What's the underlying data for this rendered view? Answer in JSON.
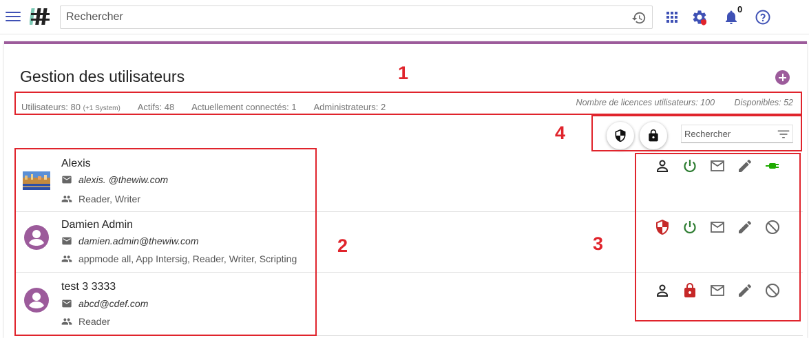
{
  "header": {
    "search_placeholder": "Rechercher",
    "notifications_count": "0",
    "icons": [
      "menu-icon",
      "app-logo",
      "history-icon",
      "apps-grid-icon",
      "admin-settings-icon",
      "bell-icon",
      "help-icon"
    ]
  },
  "page": {
    "title": "Gestion des utilisateurs",
    "accent_color": "#9c5b9b"
  },
  "stats": {
    "users": "Utilisateurs: 80",
    "users_system": "(+1 System)",
    "active": "Actifs: 48",
    "connected": "Actuellement connectés: 1",
    "admins": "Administrateurs: 2",
    "licences": "Nombre de licences utilisateurs: 100",
    "available": "Disponibles: 52"
  },
  "filter": {
    "search_placeholder": "Rechercher"
  },
  "users": [
    {
      "name": "Alexis",
      "email": "alexis. @thewiw.com",
      "groups": "Reader, Writer",
      "avatar": "photo",
      "actions": [
        "user-icon",
        "power-icon",
        "mail-icon",
        "edit-icon",
        "plug-icon"
      ]
    },
    {
      "name": "Damien Admin",
      "email": "damien.admin@thewiw.com",
      "groups": "appmode all, App Intersig, Reader, Writer, Scripting",
      "avatar": "default",
      "actions": [
        "admin-shield-icon",
        "power-icon",
        "mail-icon",
        "edit-icon",
        "block-icon"
      ]
    },
    {
      "name": "test 3 3333",
      "email": "abcd@cdef.com",
      "groups": "Reader",
      "avatar": "default",
      "actions": [
        "user-icon",
        "lock-icon",
        "mail-icon",
        "edit-icon",
        "block-icon"
      ]
    }
  ],
  "annotations": [
    "1",
    "2",
    "3",
    "4"
  ],
  "colors": {
    "annotation": "#e0242c",
    "active_green": "#2e7d32",
    "danger_red": "#c62828",
    "link_blue": "#3f51b5"
  }
}
